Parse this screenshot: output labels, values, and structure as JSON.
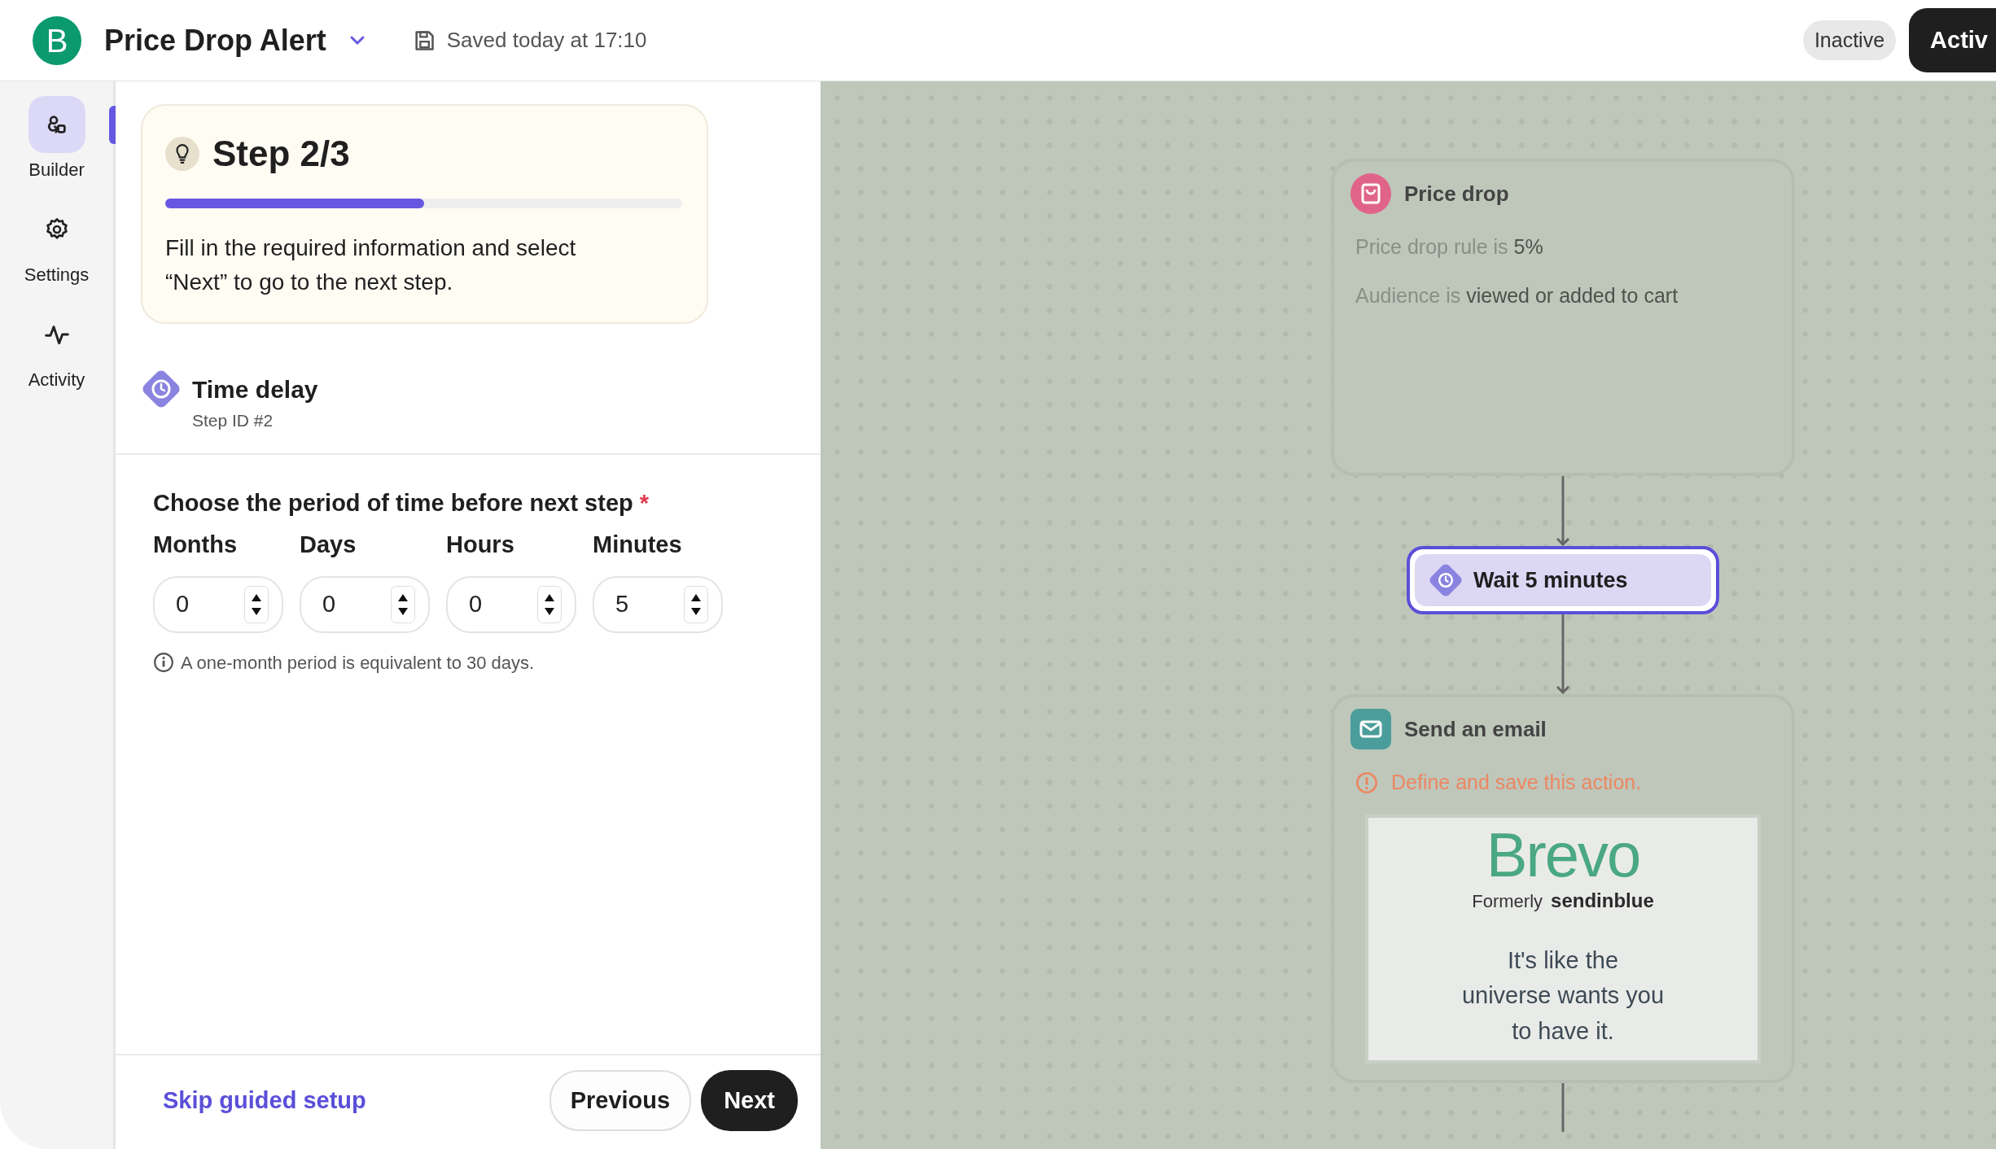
{
  "header": {
    "logo_letter": "B",
    "title": "Price Drop Alert",
    "saved": "Saved today at 17:10",
    "status_badge": "Inactive",
    "activate_button": "Activ"
  },
  "rail": {
    "items": [
      {
        "label": "Builder",
        "selected": true
      },
      {
        "label": "Settings",
        "selected": false
      },
      {
        "label": "Activity",
        "selected": false
      }
    ]
  },
  "guide": {
    "title": "Step 2/3",
    "level": 0.5,
    "text": "Fill in the required information and select “Next” to go to the next step."
  },
  "step": {
    "title": "Time delay",
    "step_id": "Step ID #2"
  },
  "form": {
    "label": "Choose the period of time before next step",
    "required_mark": "*",
    "fields": [
      {
        "label": "Months",
        "value": "0"
      },
      {
        "label": "Days",
        "value": "0"
      },
      {
        "label": "Hours",
        "value": "0"
      },
      {
        "label": "Minutes",
        "value": "5"
      }
    ],
    "note": "A one-month period is equivalent to 30 days."
  },
  "footer": {
    "skip": "Skip guided setup",
    "previous": "Previous",
    "next": "Next"
  },
  "canvas": {
    "nodes": [
      {
        "kind": "trigger",
        "title": "Price drop",
        "rules": [
          {
            "label": "Price drop rule is",
            "value": "5%"
          },
          {
            "label": "Audience is",
            "value": "viewed or added to cart"
          }
        ]
      },
      {
        "kind": "delay",
        "title": "Wait 5 minutes",
        "selected": true
      },
      {
        "kind": "email",
        "title": "Send an email",
        "warning": "Define and save this action.",
        "preview": {
          "logo": "Brevo",
          "formerly": "Formerly",
          "brand": "sendinblue",
          "tagline": "It's like the universe wants you to have it."
        }
      }
    ]
  }
}
